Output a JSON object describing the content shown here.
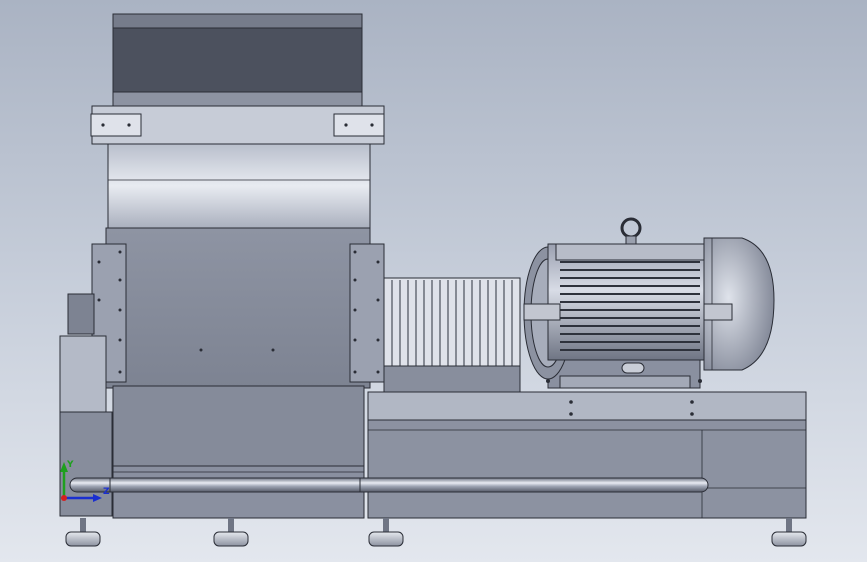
{
  "view": {
    "background_top": "#aab3c3",
    "background_bottom": "#e3e7ee",
    "steel_color": "#8f95a4",
    "edge_color": "#2a2d36"
  },
  "triad": {
    "x_label": "",
    "y_label": "Y",
    "z_label": "Z",
    "x_color": "#d42020",
    "y_color": "#1ea01e",
    "z_color": "#1a2fd0"
  },
  "parts": [
    "hopper",
    "crusher-body",
    "side-plates",
    "coupling-guard",
    "motor",
    "base-frame",
    "pipe",
    "feet"
  ]
}
